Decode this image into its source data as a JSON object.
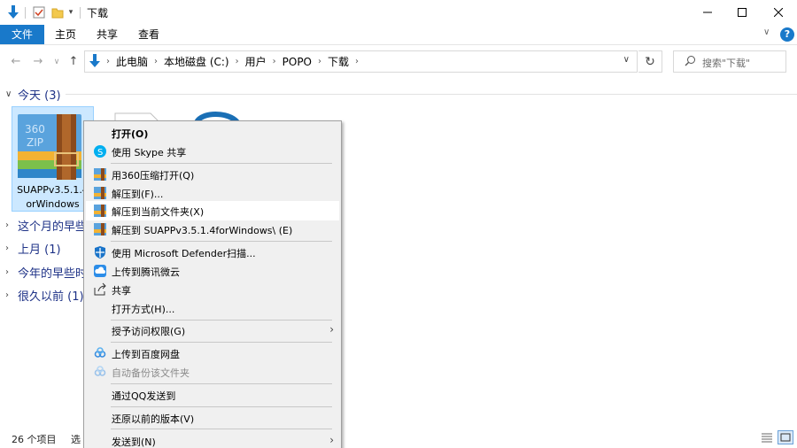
{
  "window": {
    "title": "下载"
  },
  "ribbon": {
    "tabs": [
      "文件",
      "主页",
      "共享",
      "查看"
    ],
    "help": "?"
  },
  "address": {
    "crumbs": [
      "此电脑",
      "本地磁盘 (C:)",
      "用户",
      "POPO",
      "下载"
    ],
    "search_placeholder": "搜索\"下载\""
  },
  "groups": [
    {
      "label": "今天 (3)"
    },
    {
      "label": "这个月的早些"
    },
    {
      "label": "上月 (1)"
    },
    {
      "label": "今年的早些时"
    },
    {
      "label": "很久以前 (1)"
    }
  ],
  "selected_file": {
    "name_line1": "SUAPPv3.5.1.4",
    "name_line2": "orWindows",
    "icon_text": "360 ZIP"
  },
  "status": {
    "count": "26 个项目",
    "selected": "选"
  },
  "context_menu": {
    "items": [
      {
        "label": "打开(O)"
      },
      {
        "label": "使用 Skype 共享"
      },
      {
        "label": "用360压缩打开(Q)"
      },
      {
        "label": "解压到(F)..."
      },
      {
        "label": "解压到当前文件夹(X)"
      },
      {
        "label": "解压到 SUAPPv3.5.1.4forWindows\\ (E)"
      },
      {
        "label": "使用 Microsoft Defender扫描..."
      },
      {
        "label": "上传到腾讯微云"
      },
      {
        "label": "共享"
      },
      {
        "label": "打开方式(H)..."
      },
      {
        "label": "授予访问权限(G)"
      },
      {
        "label": "上传到百度网盘"
      },
      {
        "label": "自动备份该文件夹"
      },
      {
        "label": "通过QQ发送到"
      },
      {
        "label": "还原以前的版本(V)"
      },
      {
        "label": "发送到(N)"
      }
    ]
  },
  "colors": {
    "accent": "#1979ca",
    "selection": "#cce8ff"
  }
}
